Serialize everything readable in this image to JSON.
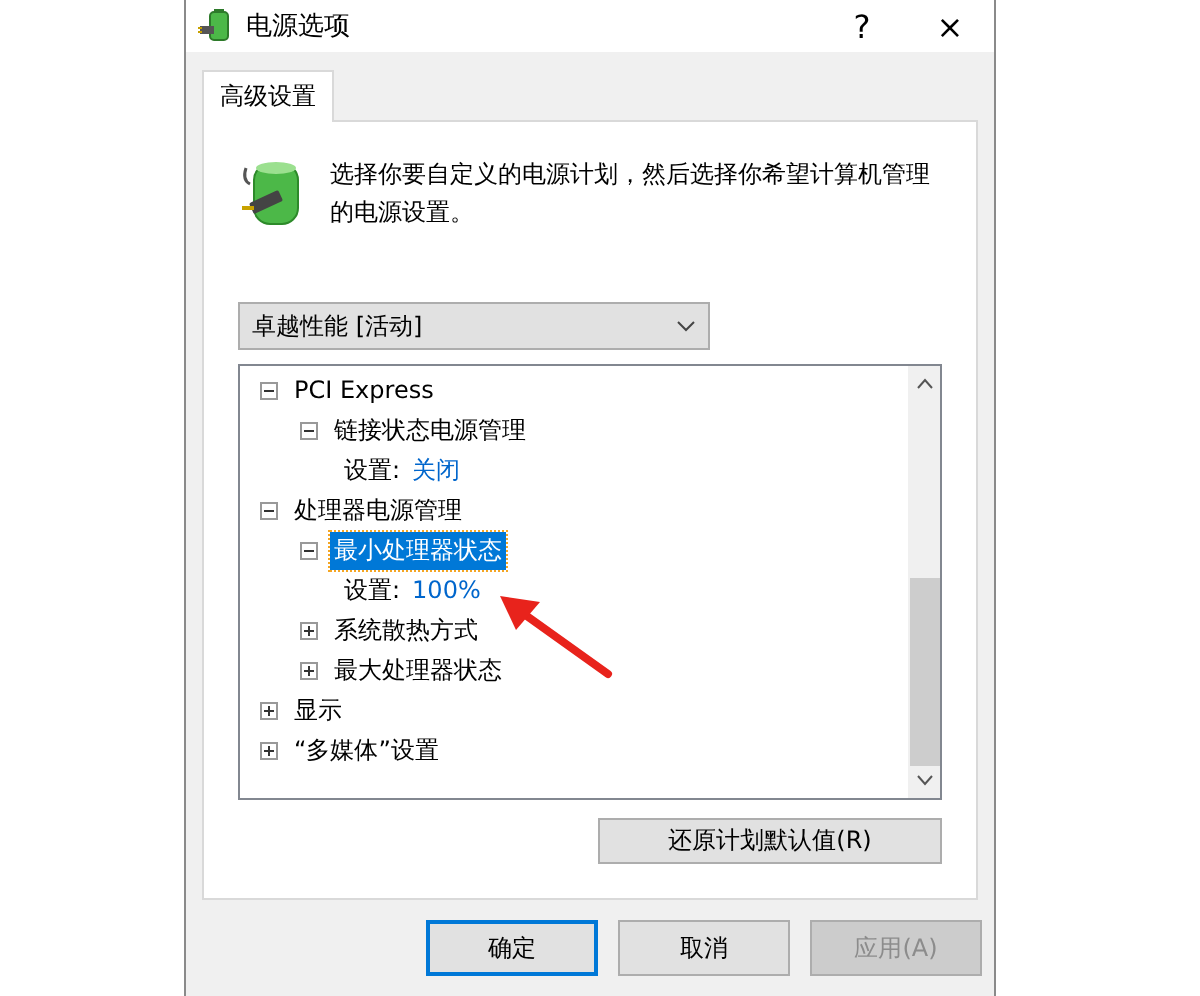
{
  "window": {
    "title": "电源选项",
    "help": "?",
    "close": "×"
  },
  "tabs": [
    {
      "label": "高级设置",
      "selected": true
    }
  ],
  "description": "选择你要自定义的电源计划，然后选择你希望计算机管理的电源设置。",
  "plan_dropdown": {
    "value": "卓越性能 [活动]"
  },
  "tree": [
    {
      "kind": "node",
      "label": "PCI Express",
      "expanded": true,
      "selected": false,
      "children": [
        {
          "kind": "node",
          "label": "链接状态电源管理",
          "expanded": true,
          "selected": false,
          "children": [
            {
              "kind": "setting",
              "label": "设置:",
              "value": "关闭"
            }
          ]
        }
      ]
    },
    {
      "kind": "node",
      "label": "处理器电源管理",
      "expanded": true,
      "selected": false,
      "children": [
        {
          "kind": "node",
          "label": "最小处理器状态",
          "expanded": true,
          "selected": true,
          "children": [
            {
              "kind": "setting",
              "label": "设置:",
              "value": "100%"
            }
          ]
        },
        {
          "kind": "node",
          "label": "系统散热方式",
          "expanded": false,
          "selected": false
        },
        {
          "kind": "node",
          "label": "最大处理器状态",
          "expanded": false,
          "selected": false
        }
      ]
    },
    {
      "kind": "node",
      "label": "显示",
      "expanded": false,
      "selected": false
    },
    {
      "kind": "node",
      "label": "“多媒体”设置",
      "expanded": false,
      "selected": false
    }
  ],
  "restore_button": "还原计划默认值(R)",
  "buttons": [
    {
      "label": "确定",
      "kind": "default",
      "disabled": false
    },
    {
      "label": "取消",
      "kind": "normal",
      "disabled": false
    },
    {
      "label": "应用(A)",
      "kind": "normal",
      "disabled": true
    }
  ]
}
